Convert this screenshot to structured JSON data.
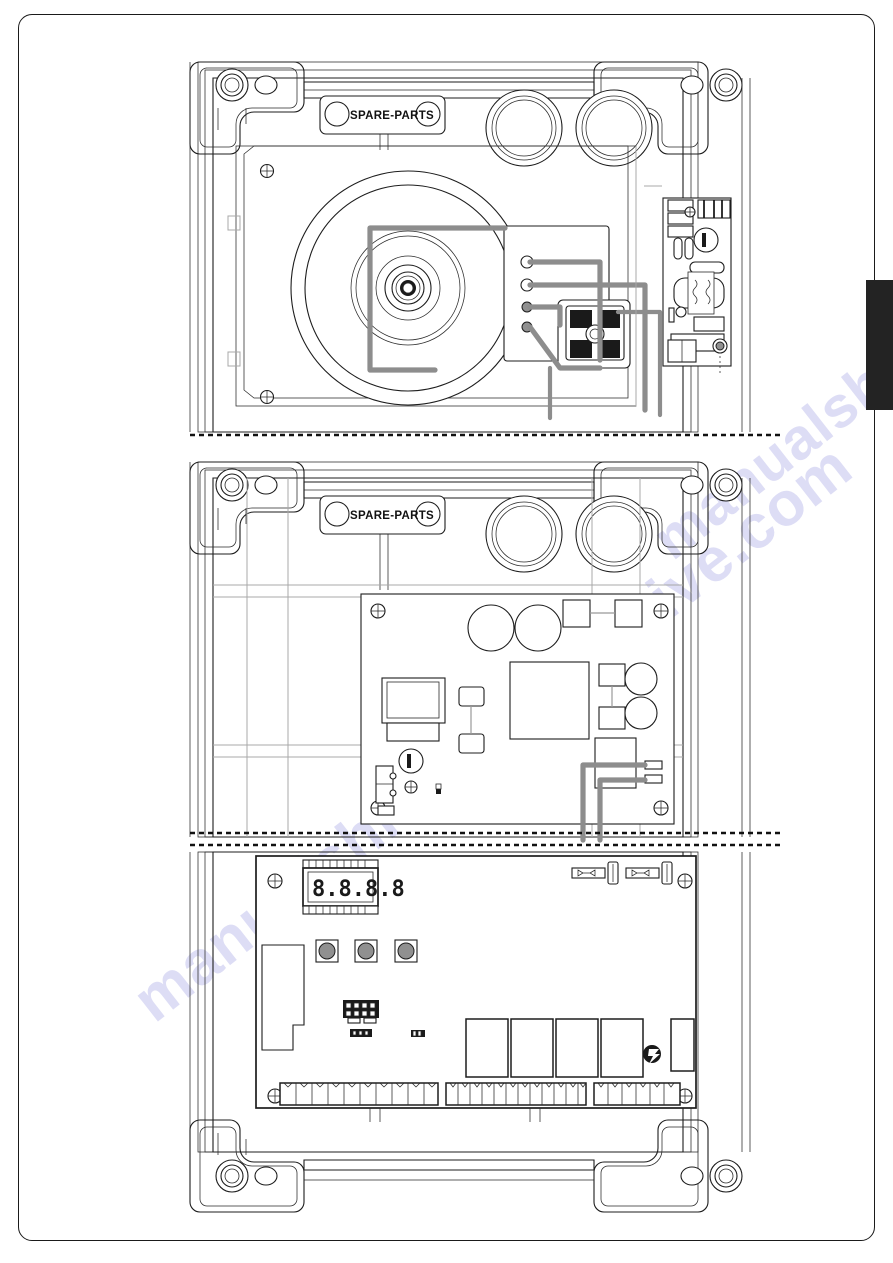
{
  "document": {
    "type": "technical-exploded-assembly-diagram",
    "page_border": "rounded-rectangle",
    "accent_color": "#1d1d1d",
    "wire_color": "#8d8d8d",
    "tab_color": "#232323",
    "watermark_text": "manualshive.com"
  },
  "side_tab": {
    "name": "page-section-tab",
    "color": "#232323"
  },
  "panels": [
    {
      "id": "panel-motor-layer",
      "title": "SPARE-PARTS",
      "label_text": "SPARE-PARTS",
      "components": {
        "cable_glands": 2,
        "mounting_corners": 2,
        "flywheel_rings": 5,
        "terminal_posts": 4,
        "pcb_modules": 1,
        "fixing_screws": 2
      }
    },
    {
      "id": "panel-pcb-layer",
      "title": "SPARE-PARTS",
      "label_text": "SPARE-PARTS",
      "components": {
        "cable_glands": 2,
        "mounting_corners": 2,
        "capacitors": 4,
        "relays": 2,
        "ic_chips": 1,
        "fixing_screws": 4,
        "connectors": 2
      }
    },
    {
      "id": "panel-control-board-layer",
      "display_value": "8.8.8.8",
      "components": {
        "pushbuttons": 3,
        "display_modules": 1,
        "fuse_holders": 2,
        "relays": 4,
        "dip_connector_pins": 10,
        "terminal_strip_left": 10,
        "terminal_strip_mid": 12,
        "terminal_strip_right": 6,
        "terminal_strip_end": 2,
        "fixing_screws": 4,
        "mounting_corners": 2
      }
    }
  ],
  "labels": {
    "spare_parts_top": "SPARE-PARTS",
    "spare_parts_mid": "SPARE-PARTS",
    "led_display": "8.8.8.8"
  }
}
